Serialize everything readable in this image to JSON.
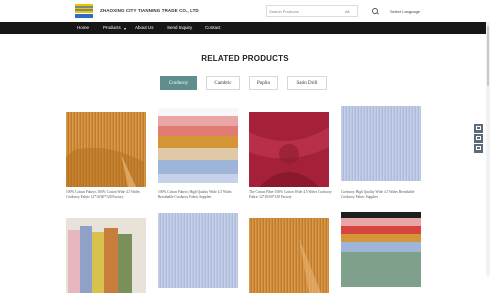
{
  "header": {
    "company_name": "ZHAOXING CITY TIANNING TRADE CO., LTD",
    "search": {
      "placeholder": "Search Products",
      "filter": "All"
    },
    "language_label": "Select Language"
  },
  "nav": {
    "items": [
      {
        "label": "Home"
      },
      {
        "label": "Products"
      },
      {
        "label": "About Us"
      },
      {
        "label": "Send Inquiry"
      },
      {
        "label": "Contact"
      }
    ]
  },
  "section": {
    "title": "RELATED PRODUCTS"
  },
  "tabs": [
    {
      "label": "Corduroy",
      "active": true
    },
    {
      "label": "Cambric",
      "active": false
    },
    {
      "label": "Poplin",
      "active": false
    },
    {
      "label": "Satin Drill",
      "active": false
    }
  ],
  "products": [
    {
      "title": "100% Cotton Fabrics 100% Cotton Wide 4.5 Wales Corduroy Fabric 12*16/60*128 Factory"
    },
    {
      "title": "100% Cotton Fabrics High Quality Wide 4.5 Wales Breathable Corduroy Fabric Supplier"
    },
    {
      "title": "The Cotton Fiber 100% Cotton Wide 4.5 Wales Corduroy Fabric 12*16/60*128 Factory"
    },
    {
      "title": "Corduroy High Quality Wide 4.5 Wales Breathable Corduroy Fabric Supplier"
    },
    {
      "title": ""
    },
    {
      "title": ""
    },
    {
      "title": ""
    },
    {
      "title": ""
    }
  ],
  "sidebar": {
    "icons": [
      "inquiry-icon",
      "email-icon",
      "message-icon"
    ]
  },
  "colors": {
    "accent": "#5e8f8e",
    "nav": "#161616"
  }
}
